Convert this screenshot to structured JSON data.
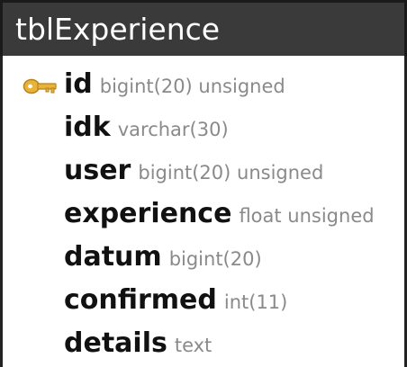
{
  "table": {
    "name": "tblExperience",
    "columns": [
      {
        "name": "id",
        "type": "bigint(20) unsigned",
        "primary_key": true
      },
      {
        "name": "idk",
        "type": "varchar(30)"
      },
      {
        "name": "user",
        "type": "bigint(20) unsigned"
      },
      {
        "name": "experience",
        "type": "float unsigned"
      },
      {
        "name": "datum",
        "type": "bigint(20)"
      },
      {
        "name": "confirmed",
        "type": "int(11)"
      },
      {
        "name": "details",
        "type": "text"
      }
    ]
  },
  "colors": {
    "header_bg": "#3a3a3a",
    "header_text": "#ffffff",
    "column_name": "#111111",
    "column_type": "#8a8a8a",
    "key_icon": "#e8b33a"
  },
  "icons": {
    "primary_key": "key-icon"
  }
}
